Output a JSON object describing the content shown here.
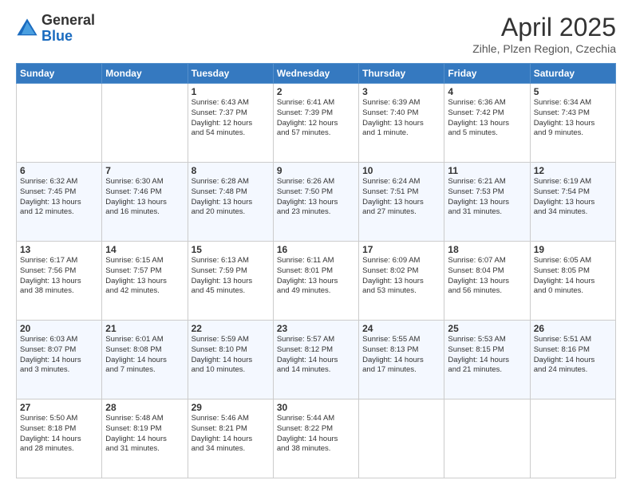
{
  "header": {
    "logo_general": "General",
    "logo_blue": "Blue",
    "month_title": "April 2025",
    "subtitle": "Zihle, Plzen Region, Czechia"
  },
  "days_of_week": [
    "Sunday",
    "Monday",
    "Tuesday",
    "Wednesday",
    "Thursday",
    "Friday",
    "Saturday"
  ],
  "weeks": [
    [
      {
        "day": "",
        "content": ""
      },
      {
        "day": "",
        "content": ""
      },
      {
        "day": "1",
        "content": "Sunrise: 6:43 AM\nSunset: 7:37 PM\nDaylight: 12 hours\nand 54 minutes."
      },
      {
        "day": "2",
        "content": "Sunrise: 6:41 AM\nSunset: 7:39 PM\nDaylight: 12 hours\nand 57 minutes."
      },
      {
        "day": "3",
        "content": "Sunrise: 6:39 AM\nSunset: 7:40 PM\nDaylight: 13 hours\nand 1 minute."
      },
      {
        "day": "4",
        "content": "Sunrise: 6:36 AM\nSunset: 7:42 PM\nDaylight: 13 hours\nand 5 minutes."
      },
      {
        "day": "5",
        "content": "Sunrise: 6:34 AM\nSunset: 7:43 PM\nDaylight: 13 hours\nand 9 minutes."
      }
    ],
    [
      {
        "day": "6",
        "content": "Sunrise: 6:32 AM\nSunset: 7:45 PM\nDaylight: 13 hours\nand 12 minutes."
      },
      {
        "day": "7",
        "content": "Sunrise: 6:30 AM\nSunset: 7:46 PM\nDaylight: 13 hours\nand 16 minutes."
      },
      {
        "day": "8",
        "content": "Sunrise: 6:28 AM\nSunset: 7:48 PM\nDaylight: 13 hours\nand 20 minutes."
      },
      {
        "day": "9",
        "content": "Sunrise: 6:26 AM\nSunset: 7:50 PM\nDaylight: 13 hours\nand 23 minutes."
      },
      {
        "day": "10",
        "content": "Sunrise: 6:24 AM\nSunset: 7:51 PM\nDaylight: 13 hours\nand 27 minutes."
      },
      {
        "day": "11",
        "content": "Sunrise: 6:21 AM\nSunset: 7:53 PM\nDaylight: 13 hours\nand 31 minutes."
      },
      {
        "day": "12",
        "content": "Sunrise: 6:19 AM\nSunset: 7:54 PM\nDaylight: 13 hours\nand 34 minutes."
      }
    ],
    [
      {
        "day": "13",
        "content": "Sunrise: 6:17 AM\nSunset: 7:56 PM\nDaylight: 13 hours\nand 38 minutes."
      },
      {
        "day": "14",
        "content": "Sunrise: 6:15 AM\nSunset: 7:57 PM\nDaylight: 13 hours\nand 42 minutes."
      },
      {
        "day": "15",
        "content": "Sunrise: 6:13 AM\nSunset: 7:59 PM\nDaylight: 13 hours\nand 45 minutes."
      },
      {
        "day": "16",
        "content": "Sunrise: 6:11 AM\nSunset: 8:01 PM\nDaylight: 13 hours\nand 49 minutes."
      },
      {
        "day": "17",
        "content": "Sunrise: 6:09 AM\nSunset: 8:02 PM\nDaylight: 13 hours\nand 53 minutes."
      },
      {
        "day": "18",
        "content": "Sunrise: 6:07 AM\nSunset: 8:04 PM\nDaylight: 13 hours\nand 56 minutes."
      },
      {
        "day": "19",
        "content": "Sunrise: 6:05 AM\nSunset: 8:05 PM\nDaylight: 14 hours\nand 0 minutes."
      }
    ],
    [
      {
        "day": "20",
        "content": "Sunrise: 6:03 AM\nSunset: 8:07 PM\nDaylight: 14 hours\nand 3 minutes."
      },
      {
        "day": "21",
        "content": "Sunrise: 6:01 AM\nSunset: 8:08 PM\nDaylight: 14 hours\nand 7 minutes."
      },
      {
        "day": "22",
        "content": "Sunrise: 5:59 AM\nSunset: 8:10 PM\nDaylight: 14 hours\nand 10 minutes."
      },
      {
        "day": "23",
        "content": "Sunrise: 5:57 AM\nSunset: 8:12 PM\nDaylight: 14 hours\nand 14 minutes."
      },
      {
        "day": "24",
        "content": "Sunrise: 5:55 AM\nSunset: 8:13 PM\nDaylight: 14 hours\nand 17 minutes."
      },
      {
        "day": "25",
        "content": "Sunrise: 5:53 AM\nSunset: 8:15 PM\nDaylight: 14 hours\nand 21 minutes."
      },
      {
        "day": "26",
        "content": "Sunrise: 5:51 AM\nSunset: 8:16 PM\nDaylight: 14 hours\nand 24 minutes."
      }
    ],
    [
      {
        "day": "27",
        "content": "Sunrise: 5:50 AM\nSunset: 8:18 PM\nDaylight: 14 hours\nand 28 minutes."
      },
      {
        "day": "28",
        "content": "Sunrise: 5:48 AM\nSunset: 8:19 PM\nDaylight: 14 hours\nand 31 minutes."
      },
      {
        "day": "29",
        "content": "Sunrise: 5:46 AM\nSunset: 8:21 PM\nDaylight: 14 hours\nand 34 minutes."
      },
      {
        "day": "30",
        "content": "Sunrise: 5:44 AM\nSunset: 8:22 PM\nDaylight: 14 hours\nand 38 minutes."
      },
      {
        "day": "",
        "content": ""
      },
      {
        "day": "",
        "content": ""
      },
      {
        "day": "",
        "content": ""
      }
    ]
  ]
}
